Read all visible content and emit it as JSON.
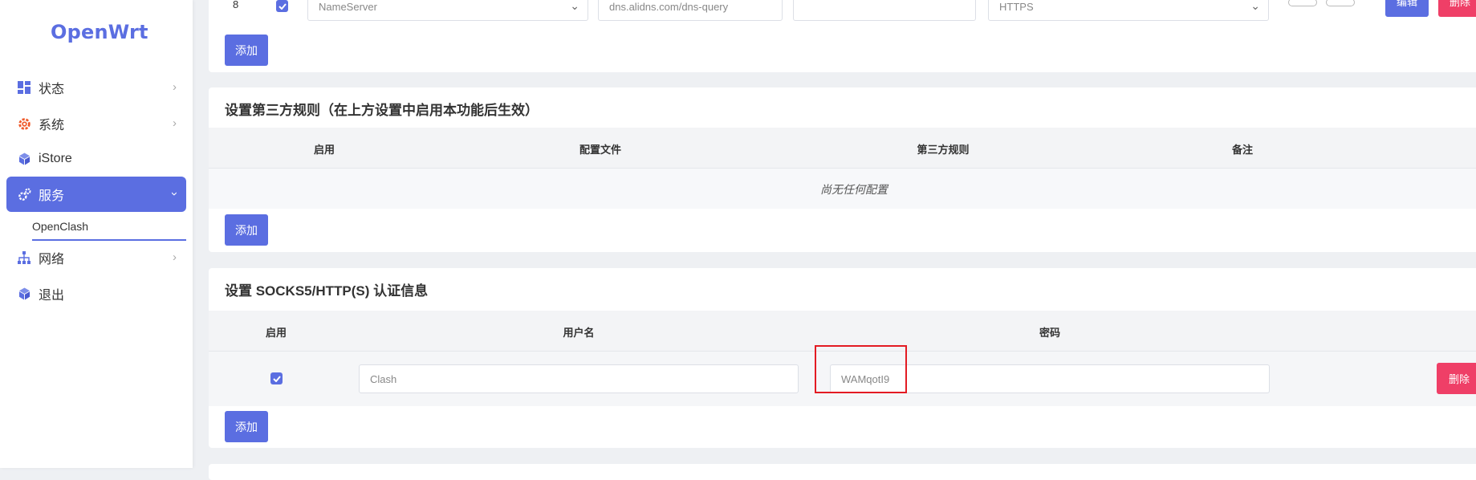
{
  "sidebar": {
    "logo": "OpenWrt",
    "items": [
      {
        "label": "状态",
        "icon": "dashboard-icon"
      },
      {
        "label": "系统",
        "icon": "gear-icon"
      },
      {
        "label": "iStore",
        "icon": "cube-icon"
      },
      {
        "label": "服务",
        "icon": "cogs-icon"
      },
      {
        "label": "网络",
        "icon": "network-icon"
      },
      {
        "label": "退出",
        "icon": "cube-icon"
      }
    ],
    "submenu": {
      "label": "OpenClash"
    }
  },
  "dns_row": {
    "index": "8",
    "type_value": "NameServer",
    "address_value": "dns.alidns.com/dns-query",
    "port_value": "",
    "protocol_value": "HTTPS",
    "edit_label": "编辑",
    "delete_label": "删除"
  },
  "add_label": "添加",
  "third_party": {
    "title": "设置第三方规则（在上方设置中启用本功能后生效）",
    "columns": [
      "启用",
      "配置文件",
      "第三方规则",
      "备注"
    ],
    "empty_text": "尚无任何配置"
  },
  "socks": {
    "title": "设置 SOCKS5/HTTP(S) 认证信息",
    "columns": [
      "启用",
      "用户名",
      "密码"
    ],
    "row": {
      "enabled": true,
      "username_placeholder": "Clash",
      "password_value": "WAMqotI9",
      "delete_label": "删除"
    }
  },
  "colors": {
    "accent": "#5b6ee1",
    "danger": "#ef3f67",
    "highlight": "#e31b23"
  }
}
